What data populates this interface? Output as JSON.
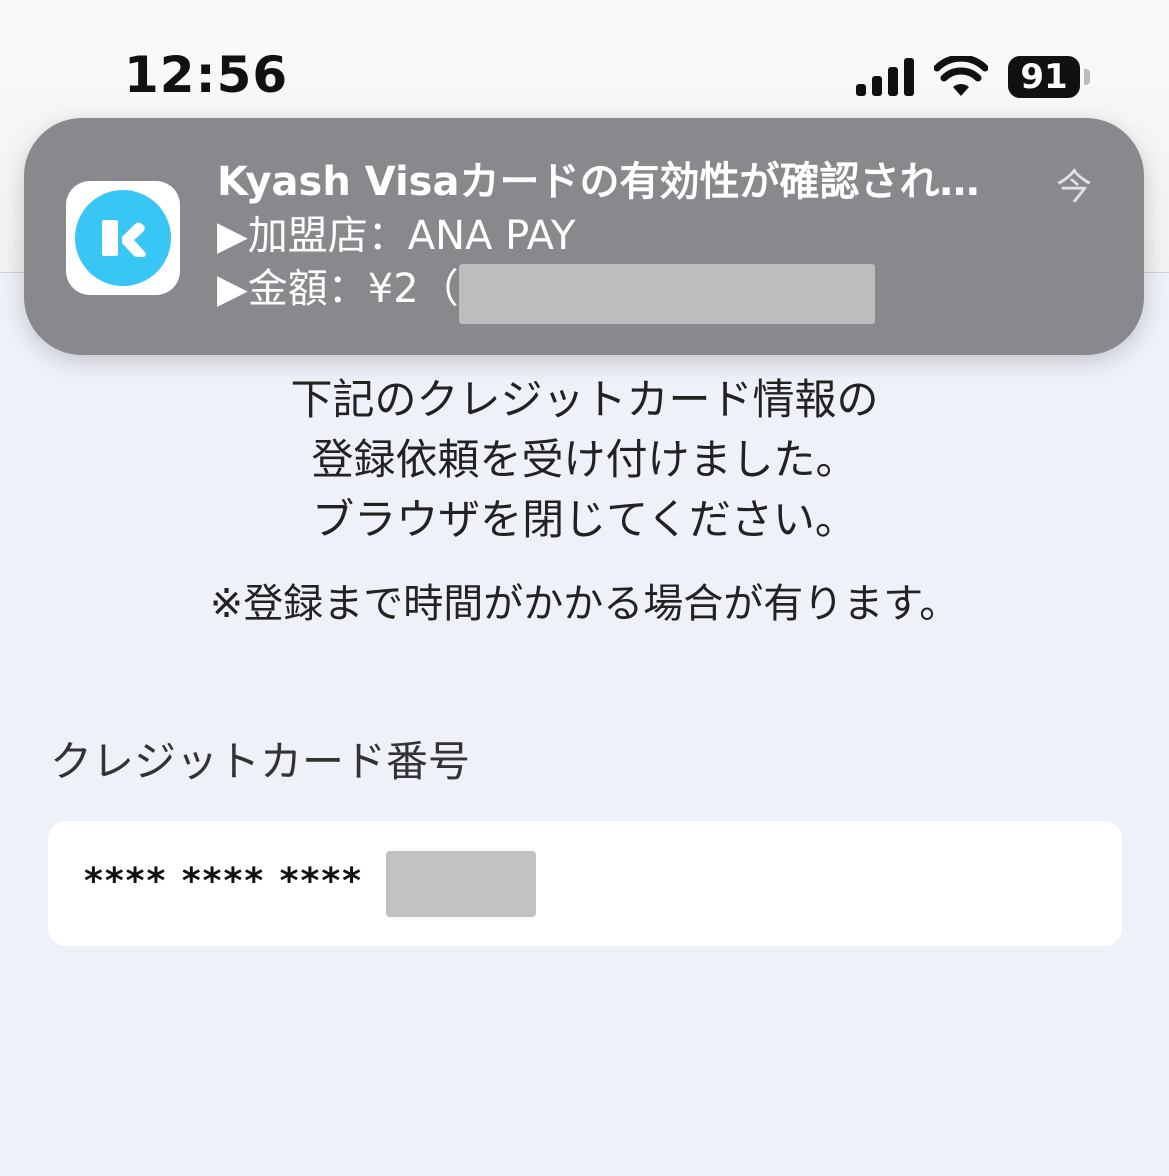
{
  "status_bar": {
    "time": "12:56",
    "battery": "91",
    "icons": [
      "cellular-signal-icon",
      "wifi-icon",
      "battery-icon"
    ]
  },
  "notification": {
    "app_icon": "kyash-app-icon",
    "title": "Kyash Visaカードの有効性が確認され…",
    "time": "今",
    "line1": "▶加盟店：ANA PAY",
    "line2": "▶金額：¥2（"
  },
  "page": {
    "message_lines": [
      "下記のクレジットカード情報の",
      "登録依頼を受け付けました。",
      "ブラウザを閉じてください。"
    ],
    "note": "※登録まで時間がかかる場合が有ります。",
    "card_field_label": "クレジットカード番号",
    "card_number_masked": "**** **** ****"
  },
  "colors": {
    "background": "#eef1f8",
    "notification_bg": "#88898d",
    "app_icon_accent": "#38c6f5"
  }
}
